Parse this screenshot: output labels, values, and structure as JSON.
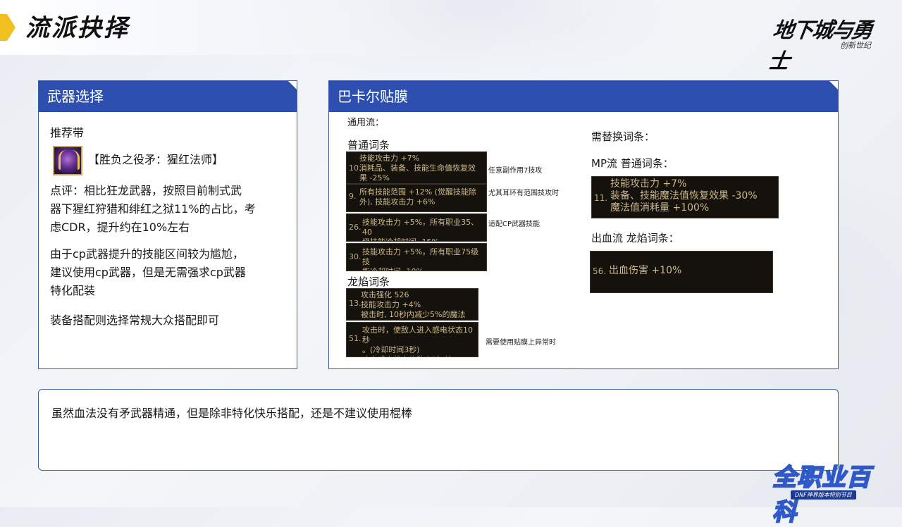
{
  "header": {
    "title": "流派抉择"
  },
  "logo": {
    "text": "地下城与勇士",
    "sub": "创新世纪"
  },
  "left_panel": {
    "title": "武器选择",
    "recommend_label": "推荐带",
    "weapon_name": "【胜负之役矛：猩红法师】",
    "comment_lines": [
      "点评：相比狂龙武器，按照目前制式武",
      "器下猩红狩猎和绯红之狱11%的占比，考",
      "虑CDR，提升约在10%左右"
    ],
    "cp_lines": [
      "由于cp武器提升的技能区间较为尴尬，",
      "建议使用cp武器，但是无需强求cp武器",
      "特化配装"
    ],
    "gear_line": "装备搭配则选择常规大众搭配即可"
  },
  "right_panel": {
    "title": "巴卡尔贴膜",
    "general_label": "通用流：",
    "normal_label": "普通词条",
    "dragon_label": "龙焰词条",
    "entries": [
      {
        "num": "10.",
        "text": "技能攻击力 +7%\n消耗品、装备、技能生命值恢复效\n果 -25%",
        "note": "任意副作用7技攻"
      },
      {
        "num": "9.",
        "text": "所有技能范围 +12% (觉醒技能除\n外), 技能攻击力 +6%",
        "note": "尤其耳环有范围技攻时"
      },
      {
        "num": "26.",
        "text": "技能攻击力 +5%，所有职业35、40\n级技能冷却时间 -15%",
        "note": "适配CP武器技能"
      },
      {
        "num": "30.",
        "text": "技能攻击力 +5%，所有职业75级技\n能冷却时间 -10%",
        "note": ""
      }
    ],
    "dragon_entries": [
      {
        "num": "13.",
        "text": "攻击强化 526\n技能攻击力 +4%\n被击时, 10秒内减少5%的魔法值..",
        "note": ""
      },
      {
        "num": "51.",
        "text": "攻击时，使敌人进入感电状态10秒\n。(冷却时间3秒)\n攻击感电状态的敌人时, 技..",
        "note": "需要使用贴膜上异常时"
      }
    ],
    "replace_label": "需替换词条：",
    "mp_label": "MP流 普通词条：",
    "mp_entry": {
      "num": "11.",
      "text": "技能攻击力 +7%\n装备、技能魔法值恢复效果 -30%\n魔法值消耗量 +100%"
    },
    "bleed_label": "出血流 龙焰词条：",
    "bleed_entry": {
      "num": "56.",
      "text": "出血伤害 +10%"
    }
  },
  "bottom_panel": {
    "text": "虽然血法没有矛武器精通，但是除非特化快乐搭配，还是不建议使用棍棒"
  },
  "badge": {
    "main": "全职业百科",
    "sub": "DNF神界版本特别节目"
  },
  "colors": {
    "panel_header": "#2d50b0",
    "panel_border": "#3b5ba8",
    "tooltip_bg": "#15120d",
    "tooltip_text": "#cdb98a"
  }
}
